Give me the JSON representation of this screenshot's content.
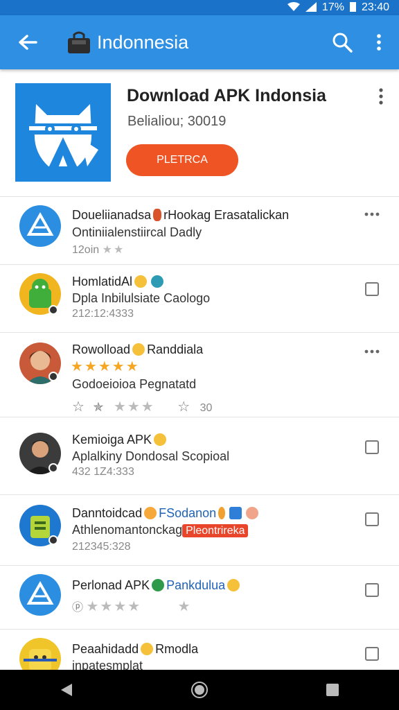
{
  "status_bar": {
    "battery": "17%",
    "time": "23:40"
  },
  "app_bar": {
    "title": "Indonnesia"
  },
  "hero": {
    "title": "Download APK Indonsia",
    "subtitle": "Belialiou; 30019",
    "button_label": "PLETRCA"
  },
  "list": [
    {
      "title": "Doueliianadsa",
      "title_extra": "rHookag Erasatalickan",
      "sub": "Ontiniialenstiircal Dadly",
      "meta": "12oin",
      "action": "more"
    },
    {
      "title": "HomlatidAl",
      "sub": "Dpla Inbilulsiate Caologo",
      "meta": "212:12:4333",
      "action": "checkbox"
    },
    {
      "title": "Rowolload",
      "title_extra": "Randdiala",
      "sub": "Godoeioioa Pegnatatd",
      "meta": "30",
      "action": "more"
    },
    {
      "title": "Kemioiga APK",
      "sub": "Aplalkiny Dondosal Scopioal",
      "meta": "432 1Z4:333",
      "action": "checkbox"
    },
    {
      "title": "Danntoidcad",
      "title_extra": "FSodanon",
      "sub": "Athlenomantonckag",
      "sub_tag": "Pleontrireka",
      "meta": "212345:328",
      "action": "checkbox"
    },
    {
      "title": "Perlonad APK",
      "title_extra": "Pankdulua",
      "sub": "",
      "meta": "",
      "action": "checkbox"
    },
    {
      "title": "Peaahidadd",
      "title_extra": "Rmodla",
      "sub": "inpatesmplat",
      "meta": "",
      "action": "checkbox"
    }
  ],
  "colors": {
    "app_bar": "#2f8fe2",
    "status_bar": "#1a73c9",
    "accent_button": "#ef5524"
  },
  "icons": [
    "back-arrow-icon",
    "bag-icon",
    "search-icon",
    "more-vert-icon",
    "back-nav-icon",
    "home-nav-icon",
    "recents-nav-icon"
  ]
}
